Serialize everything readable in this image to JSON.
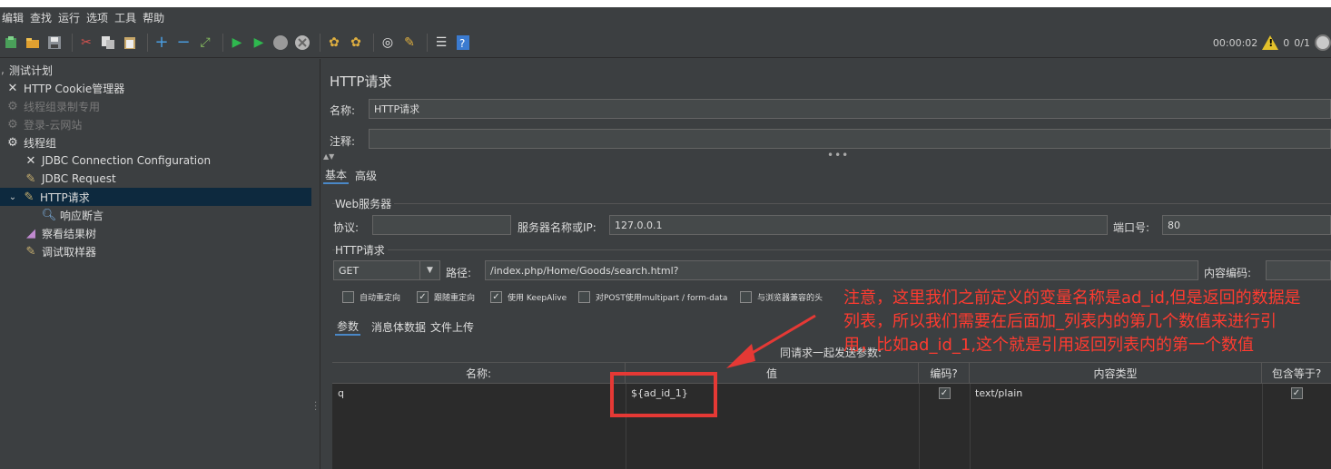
{
  "menu": [
    "编辑",
    "查找",
    "运行",
    "选项",
    "工具",
    "帮助"
  ],
  "toolbar": {
    "icons": [
      "new-plan-icon",
      "open-icon",
      "save-icon",
      "cut-icon",
      "copy-icon",
      "paste-icon",
      "expand-icon",
      "collapse-icon",
      "toggle-icon",
      "start-icon",
      "start-no-pause-icon",
      "stop-icon",
      "shutdown-icon",
      "clear-icon",
      "clear-all-icon",
      "search-icon",
      "reset-search-icon",
      "function-helper-icon",
      "help-icon"
    ],
    "elapsed": "00:00:02",
    "warnings": "0",
    "threads": "0/1"
  },
  "tree": {
    "items": [
      {
        "label": "测试计划",
        "icon": "test-plan-icon",
        "state": "normal"
      },
      {
        "label": "HTTP Cookie管理器",
        "icon": "config-element-icon",
        "state": "normal"
      },
      {
        "label": "线程组录制专用",
        "icon": "thread-group-icon",
        "state": "disabled"
      },
      {
        "label": "登录-云网站",
        "icon": "thread-group-icon",
        "state": "disabled"
      },
      {
        "label": "线程组",
        "icon": "thread-group-icon",
        "state": "normal"
      },
      {
        "label": "JDBC Connection Configuration",
        "icon": "config-element-icon",
        "state": "normal"
      },
      {
        "label": "JDBC Request",
        "icon": "sampler-icon",
        "state": "normal"
      },
      {
        "label": "HTTP请求",
        "icon": "sampler-icon",
        "state": "selected"
      },
      {
        "label": "响应断言",
        "icon": "assertion-icon",
        "state": "normal"
      },
      {
        "label": "察看结果树",
        "icon": "listener-icon",
        "state": "normal"
      },
      {
        "label": "调试取样器",
        "icon": "sampler-icon",
        "state": "normal"
      }
    ]
  },
  "panel": {
    "title": "HTTP请求",
    "name_label": "名称:",
    "name_value": "HTTP请求",
    "comment_label": "注释:",
    "comment_value": "",
    "tabs": [
      "基本",
      "高级"
    ],
    "web_server_group": "Web服务器",
    "protocol_label": "协议:",
    "protocol_value": "",
    "server_label": "服务器名称或IP:",
    "server_value": "127.0.0.1",
    "port_label": "端口号:",
    "port_value": "80",
    "http_group": "HTTP请求",
    "method": "GET",
    "path_label": "路径:",
    "path_value": "/index.php/Home/Goods/search.html?",
    "encoding_label": "内容编码:",
    "encoding_value": "",
    "checkboxes": [
      {
        "label": "自动重定向",
        "checked": false
      },
      {
        "label": "跟随重定向",
        "checked": true
      },
      {
        "label": "使用 KeepAlive",
        "checked": true
      },
      {
        "label": "对POST使用multipart / form-data",
        "checked": false
      },
      {
        "label": "与浏览器兼容的头",
        "checked": false
      }
    ],
    "sub_tabs": [
      "参数",
      "消息体数据",
      "文件上传"
    ],
    "send_params_label": "同请求一起发送参数:",
    "table": {
      "headers": [
        "名称:",
        "值",
        "编码?",
        "内容类型",
        "包含等于?"
      ],
      "rows": [
        {
          "name": "q",
          "value": "${ad_id_1}",
          "encode": true,
          "content_type": "text/plain",
          "include_equals": true
        }
      ]
    }
  },
  "annotation": {
    "line1": "注意，这里我们之前定义的变量名称是ad_id,但是返回的数据是",
    "line2": "列表，所以我们需要在后面加_列表内的第几个数值来进行引",
    "line3": "用，比如ad_id_1,这个就是引用返回列表内的第一个数值",
    "color": "#ff3b30"
  },
  "colors": {
    "background": "#3c3f41",
    "selection": "#0d293e",
    "table_bg": "#2b2b2b"
  }
}
